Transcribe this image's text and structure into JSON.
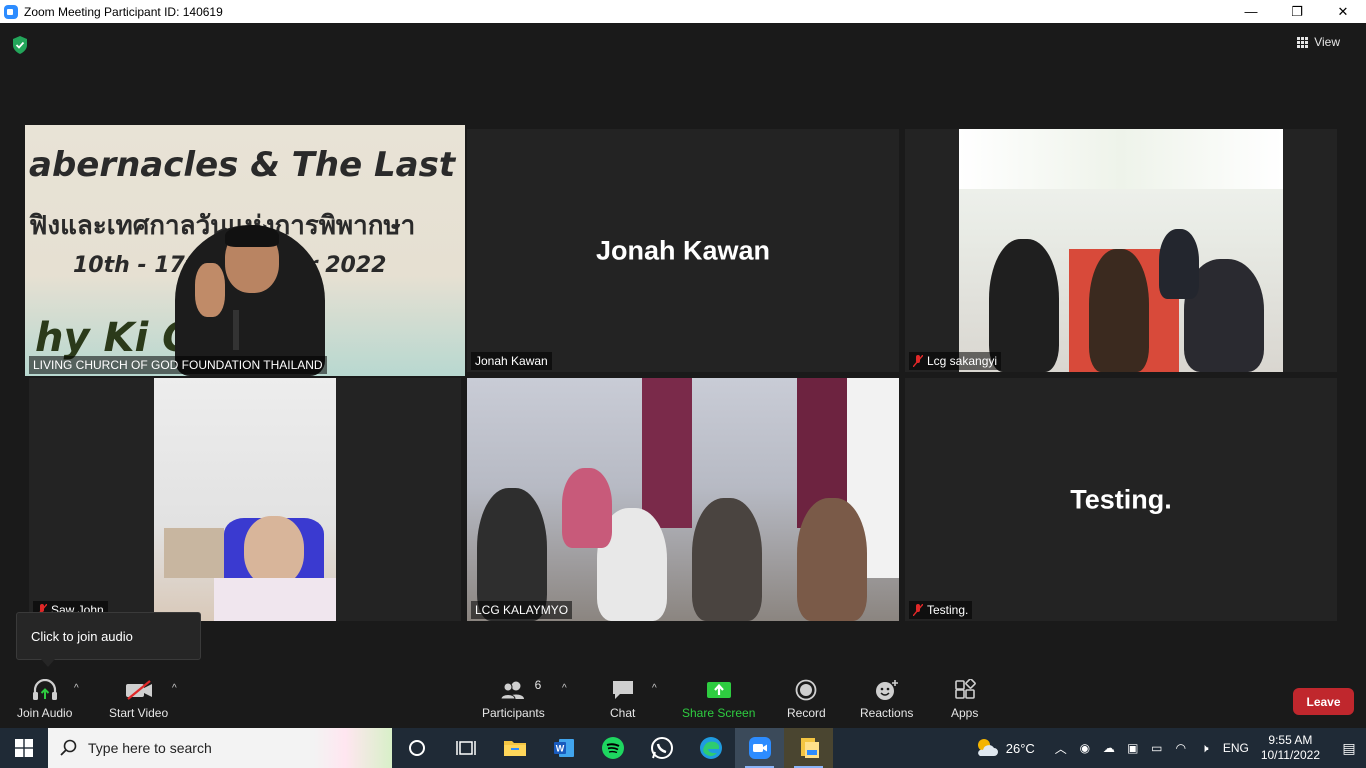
{
  "window": {
    "title": "Zoom Meeting Participant ID: 140619",
    "minimize": "—",
    "restore": "❐",
    "close": "✕"
  },
  "header": {
    "view_label": "View"
  },
  "tiles": [
    {
      "name": "LIVING CHURCH OF GOD FOUNDATION THAILAND",
      "muted": false,
      "active": true
    },
    {
      "name": "Jonah Kawan",
      "display": "Jonah Kawan",
      "muted": false
    },
    {
      "name": "Lcg sakangyi",
      "muted": true
    },
    {
      "name": "Saw John",
      "muted": true
    },
    {
      "name": "LCG KALAYMYO",
      "muted": false
    },
    {
      "name": "Testing.",
      "display": "Testing.",
      "muted": true
    }
  ],
  "banner": {
    "line1": "abernacles & The Last G",
    "line2": "ฟิงและเทศกาลวันแห่งการพิพากษา",
    "line3": "10th - 17th October 2022",
    "line4": "hy Ki    Come"
  },
  "tooltip": {
    "text": "Click to join audio"
  },
  "toolbar": {
    "join_audio": "Join Audio",
    "start_video": "Start Video",
    "participants": "Participants",
    "participants_count": "6",
    "chat": "Chat",
    "share_screen": "Share Screen",
    "record": "Record",
    "reactions": "Reactions",
    "apps": "Apps",
    "leave": "Leave",
    "caret": "^"
  },
  "taskbar": {
    "search_placeholder": "Type here to search",
    "weather": "26°C",
    "language": "ENG",
    "time": "9:55 AM",
    "date": "10/11/2022"
  },
  "colors": {
    "active_speaker": "#b3e03a",
    "share_green": "#2ecc40",
    "leave_red": "#c0272d",
    "zoom_blue": "#2d8cff"
  }
}
